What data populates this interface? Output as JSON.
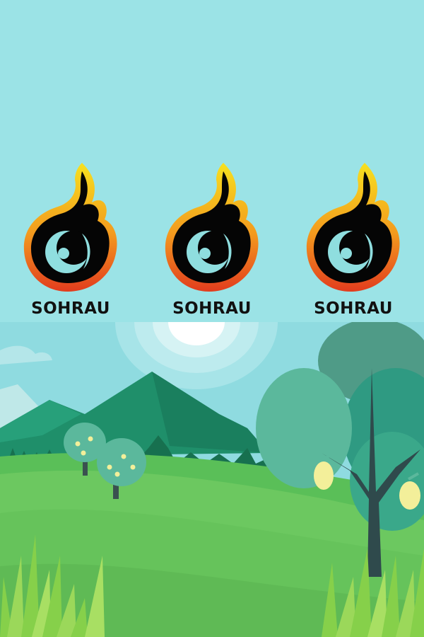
{
  "brand": {
    "name": "SOHRAU",
    "logo_icon": "flame-with-crescent-icon",
    "logo_count": 3
  },
  "colors": {
    "sky": "#9be3e6",
    "flame_outer_top": "#f5d21c",
    "flame_outer_bottom": "#e8441f",
    "flame_inner": "#050505",
    "crescent": "#8fdedf",
    "mountain": "#1f8f6a",
    "meadow": "#6cc860",
    "tree_teal": "#5bb89c",
    "lemon": "#f3ef9a"
  },
  "scene": {
    "illustration": "landscape-with-mountains-hills-and-lemon-trees"
  }
}
